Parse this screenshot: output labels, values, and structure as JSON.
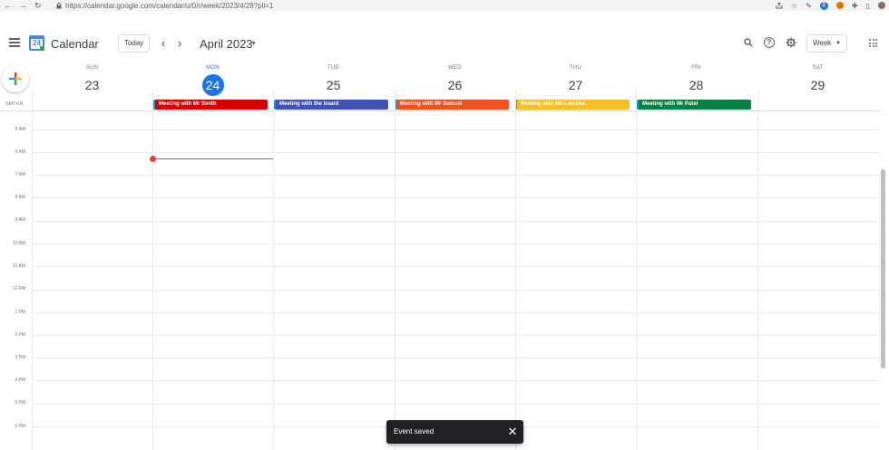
{
  "browser": {
    "back": "←",
    "forward": "→",
    "reload": "↻",
    "url": "https://calendar.google.com/calendar/u/0/r/week/2023/4/28?pli=1",
    "ext_z": "Z"
  },
  "header": {
    "logo_num": "24",
    "title": "Calendar",
    "today_label": "Today",
    "prev": "‹",
    "next": "›",
    "month": "April 2023",
    "view": "Week"
  },
  "timezone": "GMT+00",
  "days": [
    {
      "name": "SUN",
      "num": "23"
    },
    {
      "name": "MON",
      "num": "24"
    },
    {
      "name": "TUE",
      "num": "25"
    },
    {
      "name": "WED",
      "num": "26"
    },
    {
      "name": "THU",
      "num": "27"
    },
    {
      "name": "FRI",
      "num": "28"
    },
    {
      "name": "SAT",
      "num": "29"
    }
  ],
  "events": [
    {
      "title": "Meeting with Mr Smith",
      "color": "#d50000"
    },
    {
      "title": "Meeting with the board",
      "color": "#3f51b5"
    },
    {
      "title": "Meeting with Mr Samuel",
      "color": "#f4511e"
    },
    {
      "title": "Meeting with Ms Latasha",
      "color": "#f6bf26"
    },
    {
      "title": "Meeting with Mr Patel",
      "color": "#0b8043"
    }
  ],
  "time_labels": [
    "5 AM",
    "6 AM",
    "7 AM",
    "8 AM",
    "9 AM",
    "10 AM",
    "11 AM",
    "12 PM",
    "1 PM",
    "2 PM",
    "3 PM",
    "4 PM",
    "5 PM",
    "6 PM"
  ],
  "toast": {
    "message": "Event saved",
    "close": "✕"
  }
}
